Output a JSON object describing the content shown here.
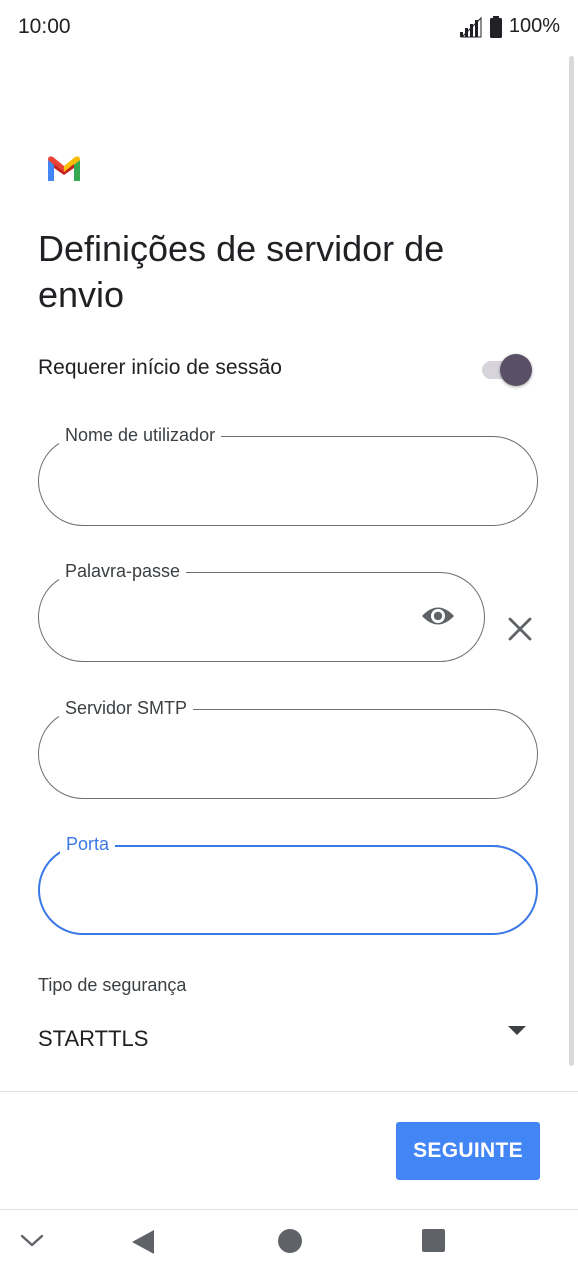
{
  "status_bar": {
    "time": "10:00",
    "battery": "100%"
  },
  "app": {
    "logo_icon": "gmail-logo"
  },
  "page": {
    "title": "Definições de servidor de envio"
  },
  "signin_toggle": {
    "label": "Requerer início de sessão",
    "state": "on"
  },
  "fields": {
    "username": {
      "label": "Nome de utilizador",
      "value": ""
    },
    "password": {
      "label": "Palavra-passe",
      "value": ""
    },
    "smtp_server": {
      "label": "Servidor SMTP",
      "value": ""
    },
    "port": {
      "label": "Porta",
      "value": ""
    }
  },
  "security": {
    "label": "Tipo de segurança",
    "value": "STARTTLS"
  },
  "actions": {
    "next_label": "SEGUINTE"
  },
  "colors": {
    "accent": "#4285f4",
    "focus_border": "#3b78e7",
    "toggle_knob": "#5a5066"
  }
}
